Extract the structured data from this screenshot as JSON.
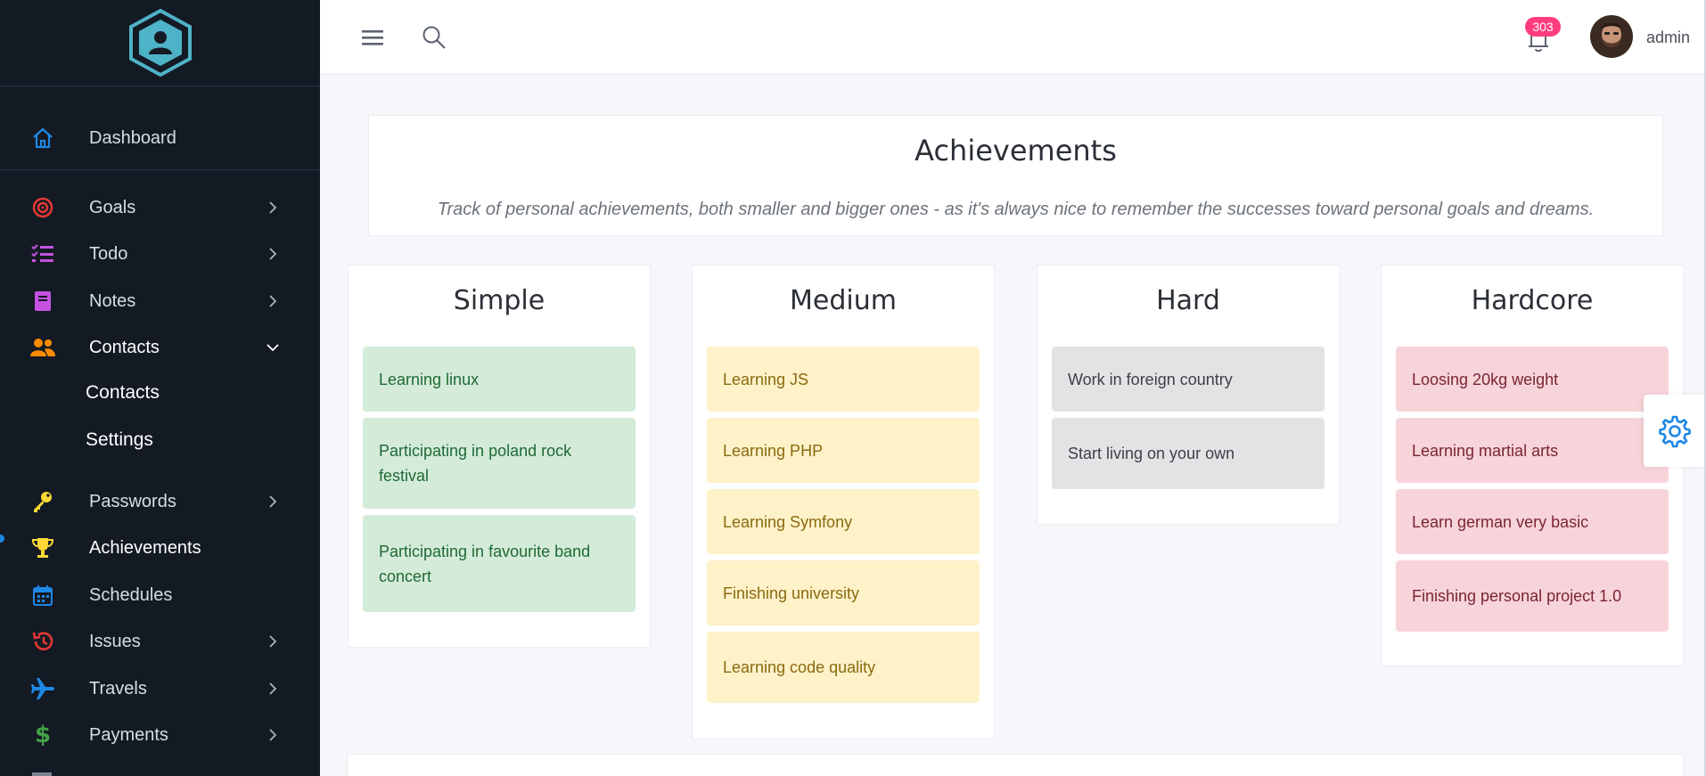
{
  "sidebar": {
    "items": [
      {
        "label": "Dashboard",
        "icon": "home-icon"
      },
      {
        "label": "Goals",
        "icon": "target-icon"
      },
      {
        "label": "Todo",
        "icon": "checklist-icon"
      },
      {
        "label": "Notes",
        "icon": "notebook-icon"
      },
      {
        "label": "Contacts",
        "icon": "users-icon"
      },
      {
        "label": "Passwords",
        "icon": "key-icon"
      },
      {
        "label": "Achievements",
        "icon": "trophy-icon"
      },
      {
        "label": "Schedules",
        "icon": "calendar-icon"
      },
      {
        "label": "Issues",
        "icon": "history-icon"
      },
      {
        "label": "Travels",
        "icon": "plane-icon"
      },
      {
        "label": "Payments",
        "icon": "dollar-icon"
      }
    ],
    "contacts_sub": [
      "Contacts",
      "Settings"
    ],
    "colors": {
      "bg": "#141a24",
      "home": "#1e88e5",
      "goals": "#e53935",
      "todo": "#c552e0",
      "notes": "#c552e0",
      "contacts": "#fb8c00",
      "passwords": "#fdd835",
      "achievements": "#fdd835",
      "schedules": "#1e88e5",
      "issues": "#e53935",
      "travels": "#1e88e5",
      "payments": "#43a047"
    }
  },
  "topbar": {
    "notification_count": "303",
    "username": "admin",
    "icons": [
      "hamburger-icon",
      "search-icon",
      "bell-icon"
    ]
  },
  "page": {
    "title": "Achievements",
    "subtitle": "Track of personal achievements, both smaller and bigger ones - as it's always nice to remember the successes toward personal goals and dreams."
  },
  "columns": [
    {
      "title": "Simple",
      "items": [
        "Learning linux",
        "Participating in poland rock festival",
        "Participating in favourite band concert"
      ]
    },
    {
      "title": "Medium",
      "items": [
        "Learning JS",
        "Learning PHP",
        "Learning Symfony",
        "Finishing university",
        "Learning code quality"
      ]
    },
    {
      "title": "Hard",
      "items": [
        "Work in foreign country",
        "Start living on your own"
      ]
    },
    {
      "title": "Hardcore",
      "items": [
        "Loosing 20kg weight",
        "Learning martial arts",
        "Learn german very basic",
        "Finishing personal project 1.0"
      ]
    }
  ]
}
